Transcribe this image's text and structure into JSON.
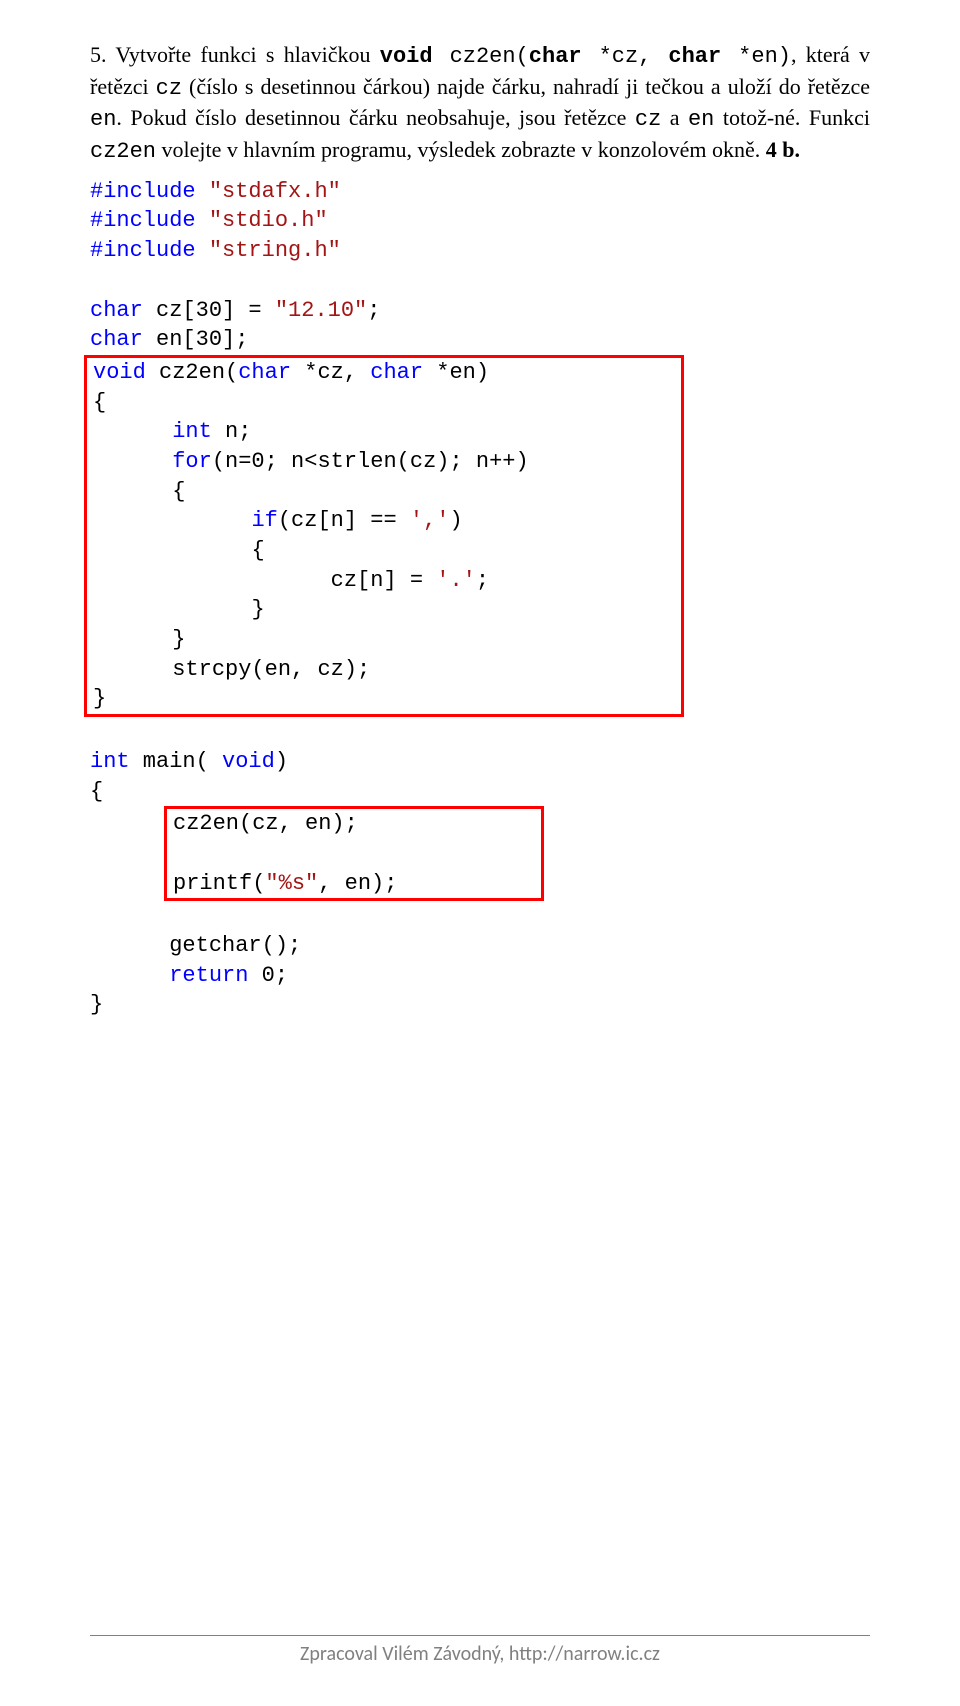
{
  "task": {
    "number": "5.",
    "text_parts": {
      "p1": "Vytvořte funkci s hlavičkou ",
      "sig_kw1": "void",
      "sig_mid1": " cz2en(",
      "sig_kw2": "char",
      "sig_mid2": " *cz, ",
      "sig_kw3": "char",
      "sig_mid3": " *en)",
      "p2": ", která v řetězci ",
      "m_cz": "cz",
      "p3": " (číslo s desetinnou čárkou) najde čárku, nahradí ji tečkou a uloží do řetězce ",
      "m_en": "en",
      "p4": ". Pokud číslo desetinnou čárku neobsahuje, jsou řetězce ",
      "m_cz2": "cz",
      "p5": " a ",
      "m_en2": "en",
      "p6": " totož-né. Funkci ",
      "m_fn": "cz2en",
      "p7": " volejte v hlavním programu, výsledek zobrazte v konzolovém okně. ",
      "points": "4 b."
    }
  },
  "code": {
    "inc_kw": "#include",
    "inc1": " \"stdafx.h\"",
    "inc2": " \"stdio.h\"",
    "inc3": " \"string.h\"",
    "char_kw": "char",
    "decl1_a": " cz[30] = ",
    "decl1_b": "\"12.10\"",
    "decl1_c": ";",
    "decl2": " en[30];",
    "void_kw": "void",
    "fn_sig_a": " cz2en(",
    "fn_sig_b": " *cz, ",
    "fn_sig_c": " *en)",
    "lbrace": "{",
    "rbrace": "}",
    "int_kw": "int",
    "n_decl": " n;",
    "for_kw": "for",
    "for_body": "(n=0; n<strlen(cz); n++)",
    "if_kw": "if",
    "if_cond_a": "(cz[n] == ",
    "if_cond_b": "','",
    "if_cond_c": ")",
    "assign_a": "cz[n] = ",
    "assign_b": "'.'",
    "assign_c": ";",
    "strcpy": "strcpy(en, cz);",
    "main_a": " main( ",
    "main_b": ")",
    "call": "cz2en(cz, en);",
    "printf_a": "printf(",
    "printf_b": "\"%s\"",
    "printf_c": ", en);",
    "getchar": "getchar();",
    "return_kw": "return",
    "return_v": " 0;"
  },
  "footer": {
    "text": "Zpracoval Vilém Závodný, http://narrow.ic.cz"
  }
}
